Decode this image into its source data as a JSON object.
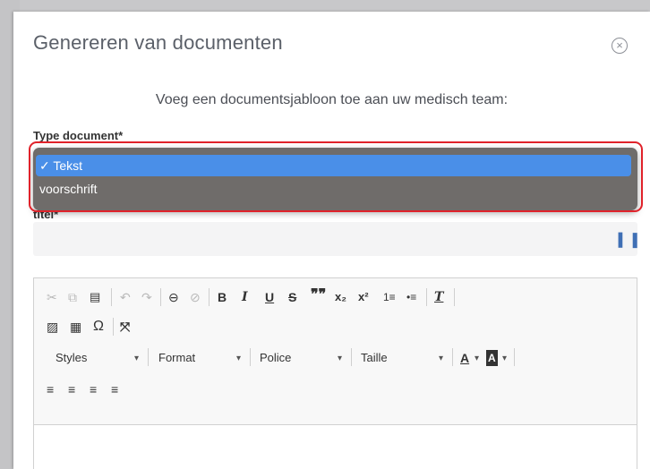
{
  "dialog": {
    "title": "Genereren van documenten",
    "close_icon": "×",
    "subtitle": "Voeg een documentsjabloon toe aan uw medisch team:"
  },
  "form": {
    "type_label": "Type document*",
    "type_options": [
      {
        "label": "✓ Tekst",
        "selected": true
      },
      {
        "label": "voorschrift",
        "selected": false
      }
    ],
    "titel_label": "titel*",
    "titel_value": "",
    "titel_icon": "▍▐"
  },
  "editor": {
    "toolbar": {
      "cut": "✂",
      "copy": "⧉",
      "paste": "📋",
      "undo": "↶",
      "redo": "↷",
      "link": "🔗",
      "unlink": "⛓",
      "bold": "B",
      "italic": "I",
      "underline": "U",
      "strike": "S",
      "blockquote": "99",
      "subscript": "x₂",
      "superscript": "x²",
      "numbered_list": "1≡",
      "bulleted_list": "•≡",
      "remove_format": "Tx",
      "image": "▨",
      "table": "▦",
      "special_char": "Ω",
      "maximize": "⤧",
      "styles": "Styles",
      "format": "Format",
      "police": "Police",
      "taille": "Taille",
      "text_color": "A",
      "bg_color": "A",
      "dropdown_caret": "▾",
      "align_left": "≡",
      "align_center": "≡",
      "align_right": "≡",
      "align_justify": "≡"
    }
  },
  "colors": {
    "accent": "#4a8fe8",
    "highlight": "#e0222a"
  }
}
